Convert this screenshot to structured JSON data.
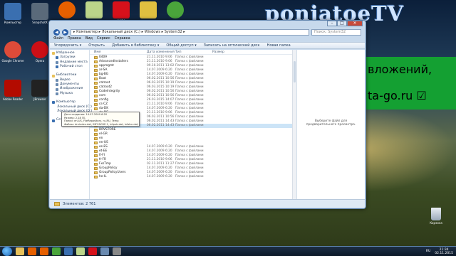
{
  "watermark": "ponjatoeTV",
  "banner": {
    "line1": "вложений,",
    "line2": "ta-go.ru ☑"
  },
  "desktop_icons": [
    {
      "label": "Компьютер",
      "icon": "computer-icon",
      "color": "#3a6fb0"
    },
    {
      "label": "SnapshotX",
      "icon": "snapshot-icon",
      "color": "#5a6a7a"
    },
    {
      "label": "Google Chrome",
      "icon": "chrome-icon",
      "color": "#dd4b39"
    },
    {
      "label": "Opera",
      "icon": "opera-icon",
      "color": "#cc0f16"
    },
    {
      "label": "Adobe Reader",
      "icon": "adobe-reader-icon",
      "color": "#b30b00"
    },
    {
      "label": "JBrowser",
      "icon": "j-icon",
      "color": "#222222"
    }
  ],
  "top_apps": [
    {
      "label": "",
      "icon": "firefox-icon",
      "color": "#e66000"
    },
    {
      "label": "",
      "icon": "notepad-icon",
      "color": "#bcd58a"
    },
    {
      "label": "AVIRA",
      "icon": "avira-icon",
      "color": "#d6111b"
    },
    {
      "label": "",
      "icon": "tag-icon",
      "color": "#e0c040"
    },
    {
      "label": "",
      "icon": "utorrent-icon",
      "color": "#4aa53b"
    }
  ],
  "window": {
    "address": "▸ Компьютер ▸ Локальный диск (C:) ▸ Windows ▸ System32 ▸",
    "search_placeholder": "Поиск: System32",
    "menu": [
      "Файл",
      "Правка",
      "Вид",
      "Сервис",
      "Справка"
    ],
    "toolbar": [
      "Упорядочить ▾",
      "Открыть",
      "Добавить в библиотеку ▾",
      "Общий доступ ▾",
      "Записать на оптический диск",
      "Новая папка"
    ],
    "nav": [
      {
        "label": "Избранное",
        "icon": "star-icon",
        "color": "#e8c15a"
      },
      {
        "label": "Загрузки",
        "icon": "downloads-icon",
        "color": "#3a6fb0"
      },
      {
        "label": "Недавние места",
        "icon": "recent-icon",
        "color": "#6a8ab0"
      },
      {
        "label": "Рабочий стол",
        "icon": "desktop-icon",
        "color": "#3a6fb0"
      },
      {
        "label": "",
        "icon": "",
        "color": "#ffffff"
      },
      {
        "label": "Библиотеки",
        "icon": "libraries-icon",
        "color": "#e8c15a"
      },
      {
        "label": "Видео",
        "icon": "video-icon",
        "color": "#6a8ab0"
      },
      {
        "label": "Документы",
        "icon": "documents-icon",
        "color": "#6a8ab0"
      },
      {
        "label": "Изображения",
        "icon": "images-icon",
        "color": "#6a8ab0"
      },
      {
        "label": "Музыка",
        "icon": "music-icon",
        "color": "#6a8ab0"
      },
      {
        "label": "",
        "icon": "",
        "color": "#ffffff"
      },
      {
        "label": "Компьютер",
        "icon": "computer-icon",
        "color": "#3a6fb0"
      },
      {
        "label": "Локальный диск (C:)",
        "icon": "drive-icon",
        "color": "#8a9aaa"
      },
      {
        "label": "Локальный диск (D:)",
        "icon": "drive-icon",
        "color": "#8a9aaa"
      },
      {
        "label": "",
        "icon": "",
        "color": "#ffffff"
      },
      {
        "label": "Сеть",
        "icon": "network-icon",
        "color": "#3a6fb0"
      }
    ],
    "columns": [
      "Имя",
      "Дата изменения",
      "Тип",
      "Размер"
    ],
    "files": [
      [
        "0409",
        "21.11.2010 9:06",
        "Папка с файлами",
        ""
      ],
      [
        "AdvancedInstallers",
        "21.11.2010 9:06",
        "Папка с файлами",
        ""
      ],
      [
        "appmgmt",
        "09.10.2011 13:02",
        "Папка с файлами",
        ""
      ],
      [
        "ar-SA",
        "14.07.2009 6:20",
        "Папка с файлами",
        ""
      ],
      [
        "bg-BG",
        "14.07.2009 6:20",
        "Папка с файлами",
        ""
      ],
      [
        "Boot",
        "06.02.2011 10:56",
        "Папка с файлами",
        ""
      ],
      [
        "catroot",
        "06.03.2015 10:19",
        "Папка с файлами",
        ""
      ],
      [
        "catroot2",
        "06.03.2015 10:19",
        "Папка с файлами",
        ""
      ],
      [
        "CodeIntegrity",
        "06.02.2011 10:56",
        "Папка с файлами",
        ""
      ],
      [
        "com",
        "06.02.2011 10:56",
        "Папка с файлами",
        ""
      ],
      [
        "config",
        "26.03.2015 14:07",
        "Папка с файлами",
        ""
      ],
      [
        "cs-CZ",
        "21.11.2010 9:06",
        "Папка с файлами",
        ""
      ],
      [
        "da-DK",
        "14.07.2009 6:20",
        "Папка с файлами",
        ""
      ],
      [
        "de-DE",
        "21.11.2010 9:06",
        "Папка с файлами",
        ""
      ],
      [
        "Dism",
        "06.02.2011 10:56",
        "Папка с файлами",
        ""
      ],
      [
        "drivers",
        "06.02.2011 14:43",
        "Папка с файлами",
        ""
      ],
      [
        "DriverStore",
        "06.02.2011 14:43",
        "Папка с файлами",
        ""
      ],
      [
        "DRVSTORE",
        "",
        "",
        ""
      ],
      [
        "el-GR",
        "",
        "",
        ""
      ],
      [
        "en",
        "",
        "",
        ""
      ],
      [
        "en-US",
        "",
        "",
        ""
      ],
      [
        "es-ES",
        "14.07.2009 6:20",
        "Папка с файлами",
        ""
      ],
      [
        "et-EE",
        "14.07.2009 6:20",
        "Папка с файлами",
        ""
      ],
      [
        "fi-FI",
        "14.07.2009 6:20",
        "Папка с файлами",
        ""
      ],
      [
        "fr-FR",
        "21.11.2010 9:06",
        "Папка с файлами",
        ""
      ],
      [
        "FxsTmp",
        "02.11.2011 11:27",
        "Папка с файлами",
        ""
      ],
      [
        "GroupPolicy",
        "14.07.2009 6:20",
        "Папка с файлами",
        ""
      ],
      [
        "GroupPolicyUsers",
        "14.07.2009 6:20",
        "Папка с файлами",
        ""
      ],
      [
        "he-IL",
        "14.07.2009 6:20",
        "Папка с файлами",
        ""
      ]
    ],
    "tooltip": [
      "Дата создания: 14.07.2009 6:20",
      "Размер: 2,18 ГБ",
      "Папки: en-US, FileRepository, ru-RU, Temp",
      "Файлы: drvindex.dat, INFCACHE.1, infpub.dat, infstrn.dat, ..."
    ],
    "preview_message": "Выберите файл для предварительного просмотра.",
    "status": "Элементов: 2 761"
  },
  "recycle_bin": "Корзина",
  "taskbar": {
    "apps": [
      {
        "icon": "explorer-icon",
        "color": "#e8c15a"
      },
      {
        "icon": "media-player-icon",
        "color": "#e66000"
      },
      {
        "icon": "firefox-icon",
        "color": "#e66000"
      },
      {
        "icon": "utorrent-icon",
        "color": "#4aa53b"
      },
      {
        "icon": "app-icon",
        "color": "#3a6fb0"
      },
      {
        "icon": "notepad-icon",
        "color": "#bcd58a"
      },
      {
        "icon": "avira-icon",
        "color": "#d6111b"
      },
      {
        "icon": "app-icon",
        "color": "#6a8ab0"
      },
      {
        "icon": "app-icon",
        "color": "#888888"
      }
    ],
    "lang": "RU",
    "time": "21:34",
    "date": "02.11.2015"
  }
}
